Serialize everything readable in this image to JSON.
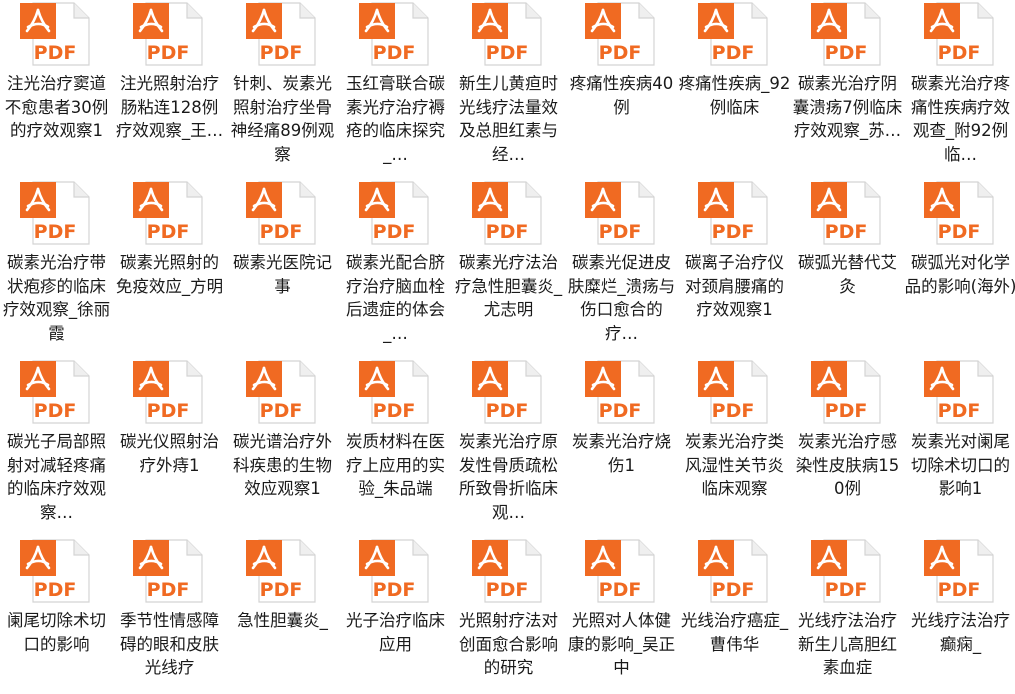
{
  "icon": {
    "name": "pdf-file-icon",
    "badge_text": "PDF",
    "accent": "#f06a22",
    "page_color": "#ffffff",
    "edge_color": "#d4d4d4"
  },
  "files": [
    [
      "注光治疗窦道不愈患者30例的疗效观察1",
      "注光照射治疗肠粘连128例疗效观察_王…",
      "针刺、炭素光照射治疗坐骨神经痛89例观察",
      "玉红膏联合碳素光疗治疗褥疮的临床探究_…",
      "新生儿黄疸时光线疗法量效及总胆红素与经…",
      "疼痛性疾病40例",
      "疼痛性疾病_92例临床",
      "碳素光治疗阴囊溃疡7例临床疗效观察_苏…",
      "碳素光治疗疼痛性疾病疗效观查_附92例临…"
    ],
    [
      "碳素光治疗带状疱疹的临床疗效观察_徐丽霞",
      "碳素光照射的免疫效应_方明",
      "碳素光医院记事",
      "碳素光配合脐疗治疗脑血栓后遗症的体会_…",
      "碳素光疗法治疗急性胆囊炎_尤志明",
      "碳素光促进皮肤糜烂_溃疡与伤口愈合的疗…",
      "碳离子治疗仪对颈肩腰痛的疗效观察1",
      "碳弧光替代艾灸",
      "碳弧光对化学品的影响(海外)"
    ],
    [
      "碳光子局部照射对减轻疼痛的临床疗效观察…",
      "碳光仪照射治疗外痔1",
      "碳光谱治疗外科疾患的生物效应观察1",
      "炭质材料在医疗上应用的实验_朱品端",
      "炭素光治疗原发性骨质疏松所致骨折临床观…",
      "炭素光治疗烧伤1",
      "炭素光治疗类风湿性关节炎临床观察",
      "炭素光治疗感染性皮肤病150例",
      "炭素光对阑尾切除术切口的影响1"
    ],
    [
      "阑尾切除术切口的影响",
      "季节性情感障碍的眼和皮肤光线疗",
      "急性胆囊炎_",
      "光子治疗临床应用",
      "光照射疗法对创面愈合影响的研究",
      "光照对人体健康的影响_吴正中",
      "光线治疗癌症_曹伟华",
      "光线疗法治疗新生儿高胆红素血症",
      "光线疗法治疗癫痫_"
    ]
  ]
}
